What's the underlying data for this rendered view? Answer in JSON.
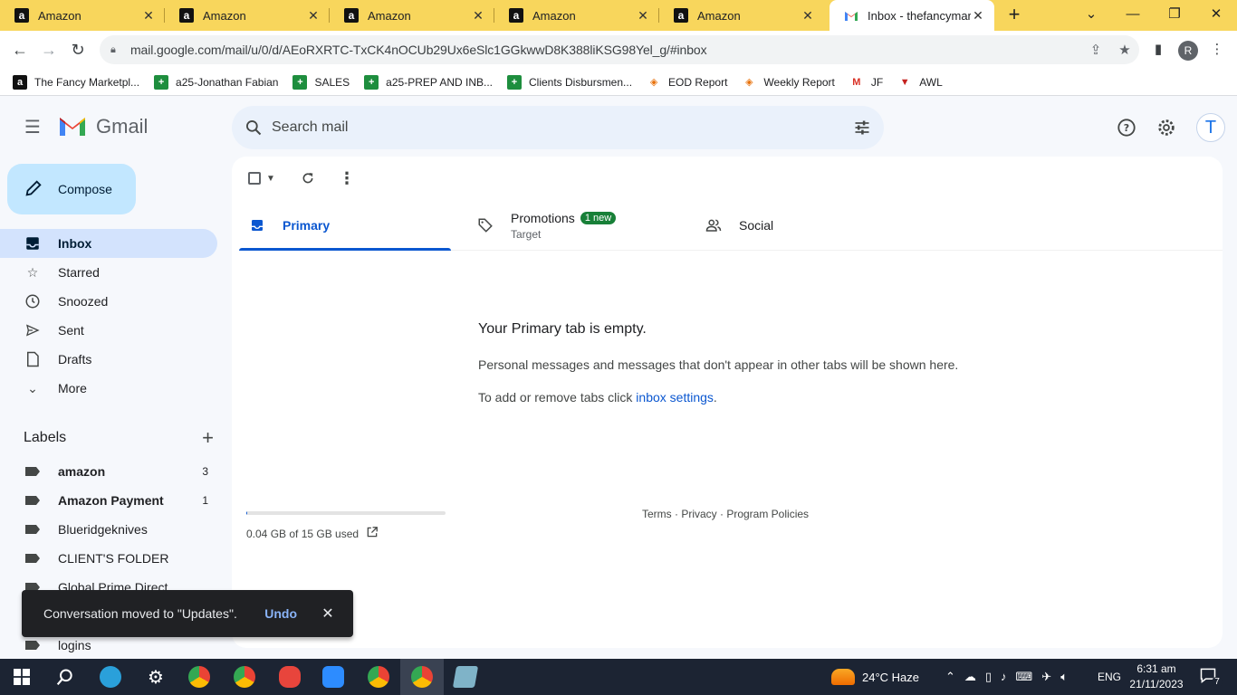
{
  "browser": {
    "tabs": [
      {
        "title": "Amazon",
        "favicon": "amazon-icon"
      },
      {
        "title": "Amazon",
        "favicon": "amazon-icon"
      },
      {
        "title": "Amazon",
        "favicon": "amazon-icon"
      },
      {
        "title": "Amazon",
        "favicon": "amazon-icon"
      },
      {
        "title": "Amazon",
        "favicon": "amazon-icon"
      },
      {
        "title": "Inbox - thefancymark",
        "favicon": "gmail-icon",
        "active": true
      }
    ],
    "url": "mail.google.com/mail/u/0/d/AEoRXRTC-TxCK4nOCUb29Ux6eSlc1GGkwwD8K388liKSG98Yel_g/#inbox",
    "profile_initial": "R",
    "bookmarks": [
      {
        "label": "The Fancy Marketpl...",
        "icon": "amazon-icon"
      },
      {
        "label": "a25-Jonathan Fabian",
        "icon": "sheets-icon"
      },
      {
        "label": "SALES",
        "icon": "sheets-icon"
      },
      {
        "label": "a25-PREP AND INB...",
        "icon": "sheets-icon"
      },
      {
        "label": "Clients Disbursmen...",
        "icon": "sheets-icon"
      },
      {
        "label": "EOD Report",
        "icon": "report-icon"
      },
      {
        "label": "Weekly Report",
        "icon": "report-icon"
      },
      {
        "label": "JF",
        "icon": "gmail-icon"
      },
      {
        "label": "AWL",
        "icon": "awl-icon"
      }
    ]
  },
  "gmail": {
    "brand": "Gmail",
    "search_placeholder": "Search mail",
    "account_initial": "T",
    "compose_label": "Compose",
    "nav": [
      {
        "label": "Inbox",
        "icon": "inbox-icon",
        "active": true
      },
      {
        "label": "Starred",
        "icon": "star-icon"
      },
      {
        "label": "Snoozed",
        "icon": "clock-icon"
      },
      {
        "label": "Sent",
        "icon": "send-icon"
      },
      {
        "label": "Drafts",
        "icon": "draft-icon"
      },
      {
        "label": "More",
        "icon": "chevron-down-icon"
      }
    ],
    "labels_heading": "Labels",
    "labels": [
      {
        "name": "amazon",
        "count": "3",
        "bold": true
      },
      {
        "name": "Amazon Payment",
        "count": "1",
        "bold": true
      },
      {
        "name": "Blueridgeknives",
        "count": ""
      },
      {
        "name": "CLIENT'S FOLDER",
        "count": ""
      },
      {
        "name": "Global Prime Direct",
        "count": ""
      },
      {
        "name": "",
        "count": ""
      },
      {
        "name": "logins",
        "count": ""
      }
    ],
    "tabs": {
      "primary": "Primary",
      "promotions": "Promotions",
      "promotions_badge": "1 new",
      "promotions_sub": "Target",
      "social": "Social"
    },
    "empty": {
      "heading": "Your Primary tab is empty.",
      "body": "Personal messages and messages that don't appear in other tabs will be shown here.",
      "settings_prefix": "To add or remove tabs click ",
      "settings_link": "inbox settings",
      "settings_suffix": "."
    },
    "storage": {
      "text": "0.04 GB of 15 GB used",
      "used_fraction": 0.003
    },
    "footer": "Terms · Privacy · Program Policies",
    "snackbar": {
      "message": "Conversation moved to \"Updates\".",
      "action": "Undo"
    }
  },
  "taskbar": {
    "weather": "24°C  Haze",
    "language": "ENG",
    "time": "6:31 am",
    "date": "21/11/2023",
    "notifications": "7"
  },
  "colors": {
    "tabstrip": "#f8d65c",
    "gmail_bg": "#f6f8fc",
    "compose": "#c2e7ff",
    "active_nav": "#d3e3fd",
    "accent": "#0b57d0",
    "badge": "#188038",
    "taskbar": "#1c2433"
  }
}
